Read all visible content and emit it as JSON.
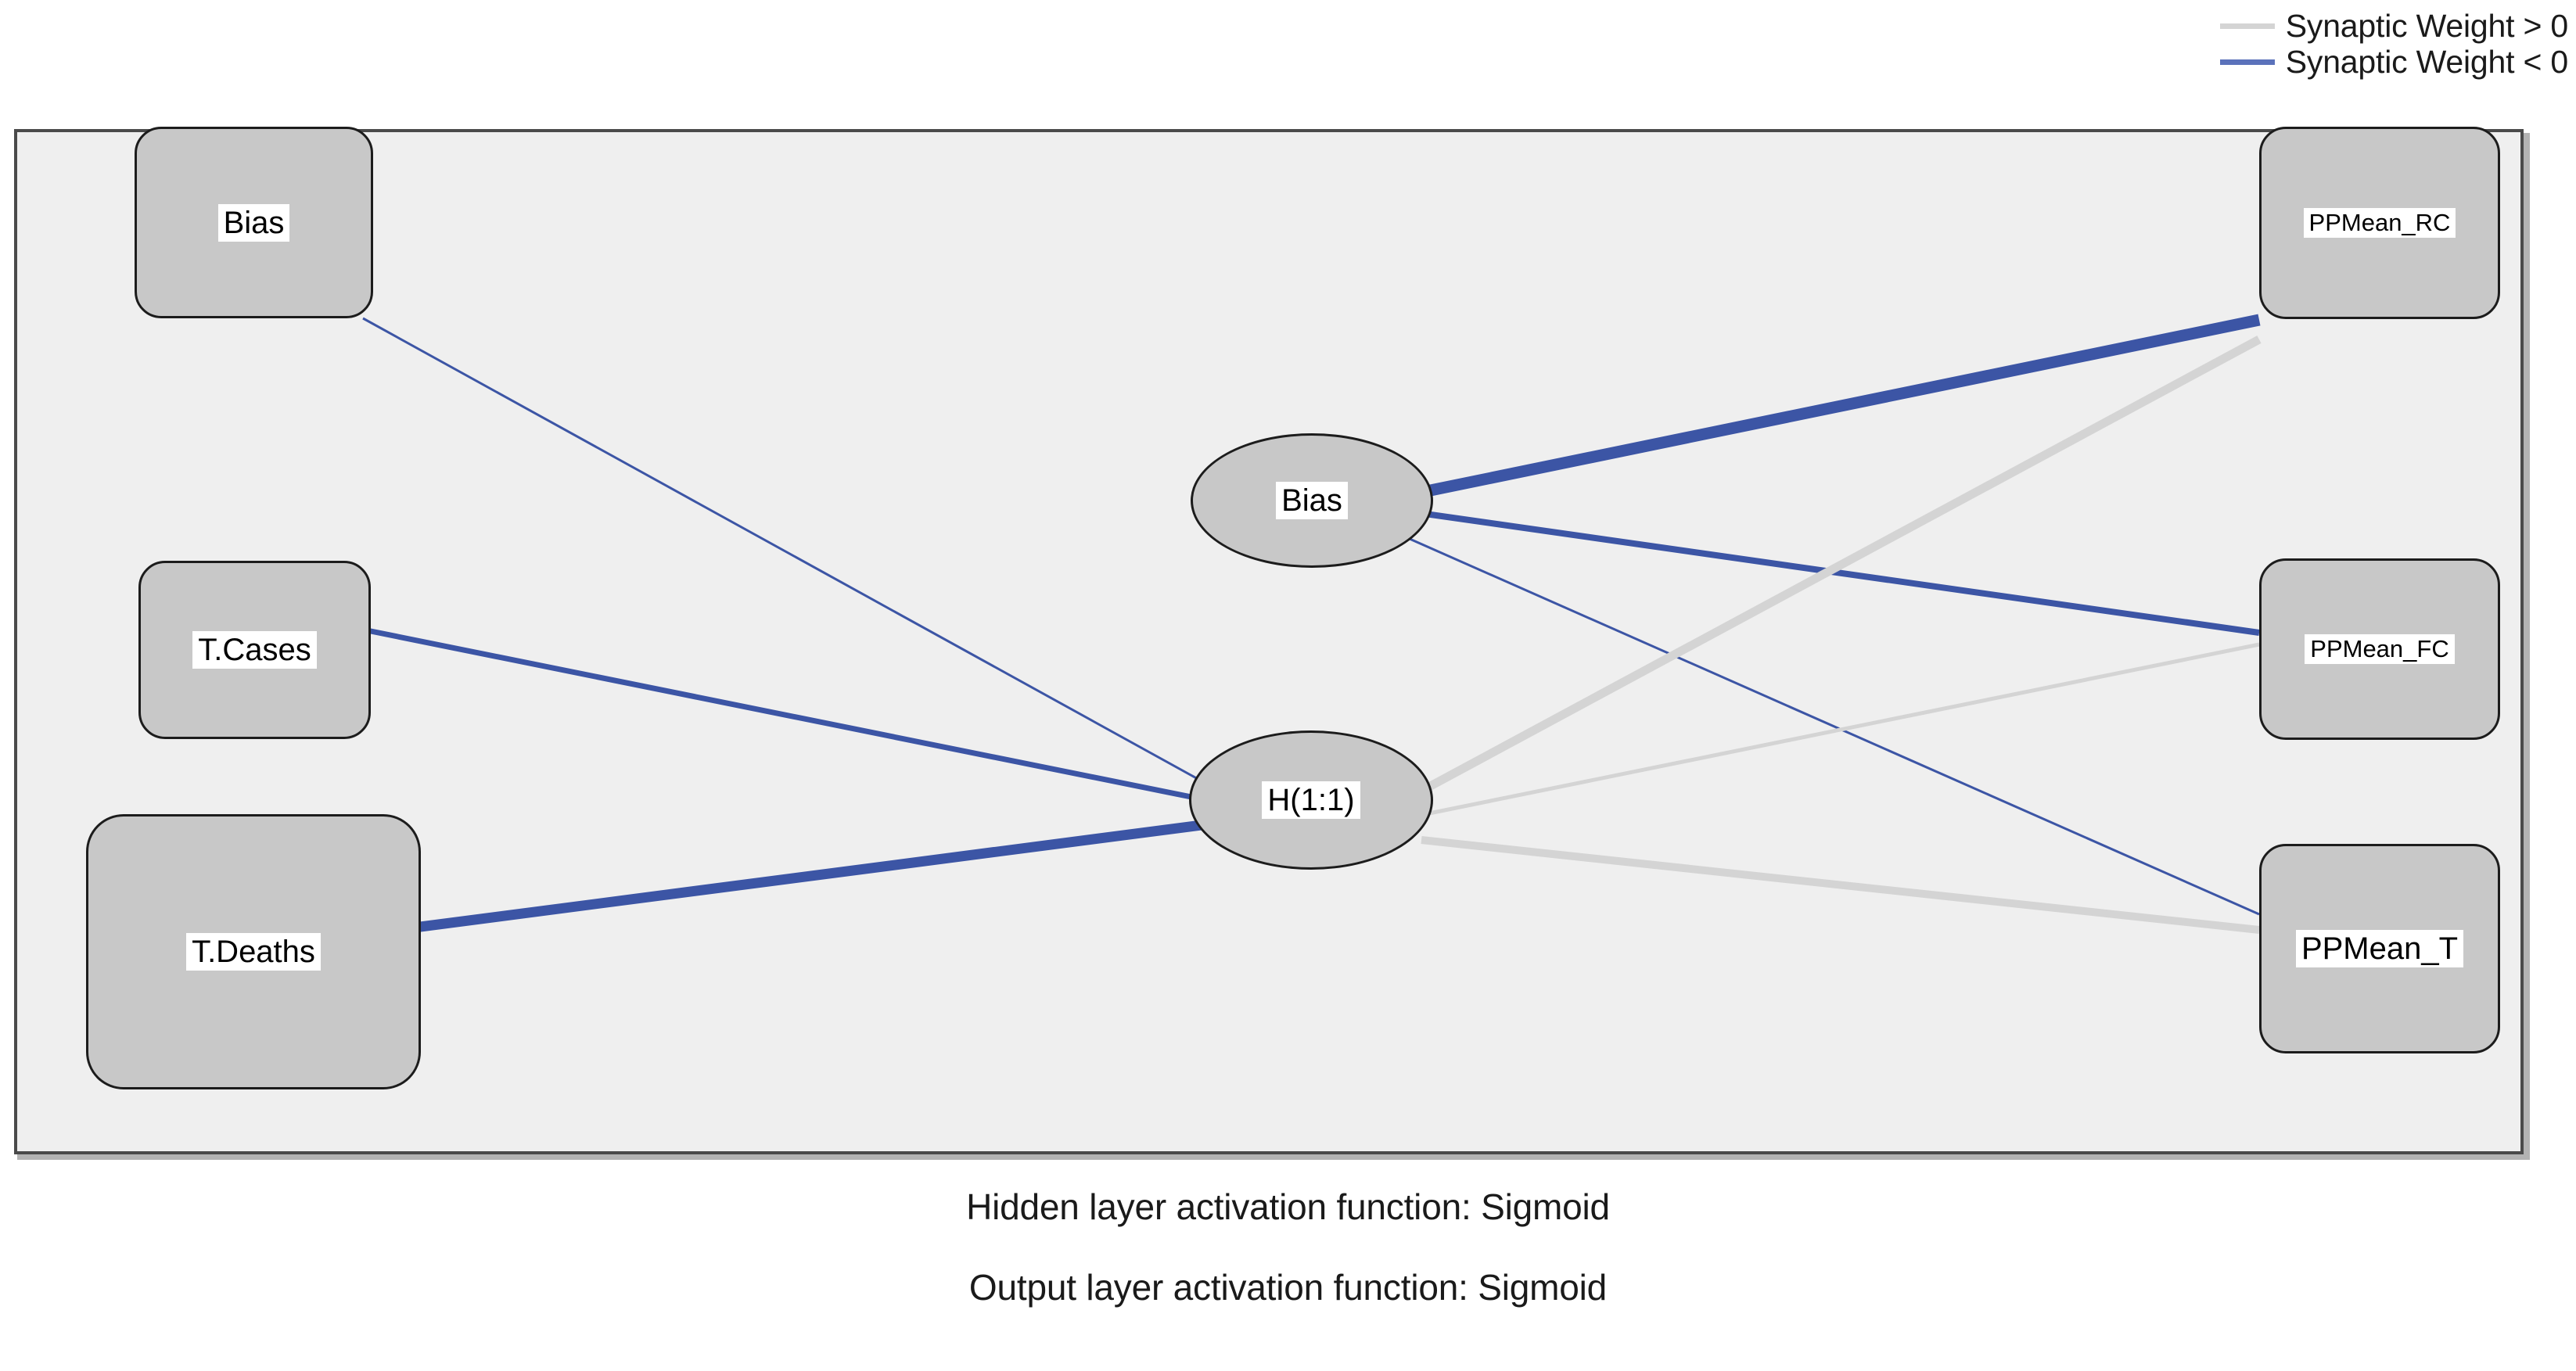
{
  "legend": {
    "items": [
      {
        "label": "Synaptic Weight > 0",
        "swatch_color": "#d4d4d4",
        "sign": "positive"
      },
      {
        "label": "Synaptic Weight < 0",
        "swatch_color": "#5b72bb",
        "sign": "negative"
      }
    ]
  },
  "diagram": {
    "type": "neural-network",
    "panel_background": "#efefef",
    "node_fill": "#c8c8c8",
    "node_border": "#1c1c1c",
    "positive_edge_color": "#d4d4d4",
    "negative_edge_color": "#3c55a5",
    "input_layer": [
      {
        "id": "in_bias",
        "label": "Bias"
      },
      {
        "id": "in_cases",
        "label": "T.Cases"
      },
      {
        "id": "in_deaths",
        "label": "T.Deaths"
      }
    ],
    "hidden_layer": [
      {
        "id": "h_bias",
        "label": "Bias"
      },
      {
        "id": "h_1_1",
        "label": "H(1:1)"
      }
    ],
    "output_layer": [
      {
        "id": "out_rc",
        "label": "PPMean_RC"
      },
      {
        "id": "out_fc",
        "label": "PPMean_FC"
      },
      {
        "id": "out_t",
        "label": "PPMean_T"
      }
    ],
    "edges": [
      {
        "from": "in_bias",
        "to": "h_1_1",
        "sign": "negative",
        "width": 3
      },
      {
        "from": "in_cases",
        "to": "h_1_1",
        "sign": "negative",
        "width": 7
      },
      {
        "from": "in_deaths",
        "to": "h_1_1",
        "sign": "negative",
        "width": 13
      },
      {
        "from": "h_bias",
        "to": "out_rc",
        "sign": "negative",
        "width": 15
      },
      {
        "from": "h_bias",
        "to": "out_fc",
        "sign": "negative",
        "width": 8
      },
      {
        "from": "h_bias",
        "to": "out_t",
        "sign": "negative",
        "width": 3
      },
      {
        "from": "h_1_1",
        "to": "out_rc",
        "sign": "positive",
        "width": 11
      },
      {
        "from": "h_1_1",
        "to": "out_fc",
        "sign": "positive",
        "width": 5
      },
      {
        "from": "h_1_1",
        "to": "out_t",
        "sign": "positive",
        "width": 10
      }
    ]
  },
  "captions": {
    "hidden": "Hidden layer activation function: Sigmoid",
    "output": "Output layer activation function: Sigmoid"
  }
}
